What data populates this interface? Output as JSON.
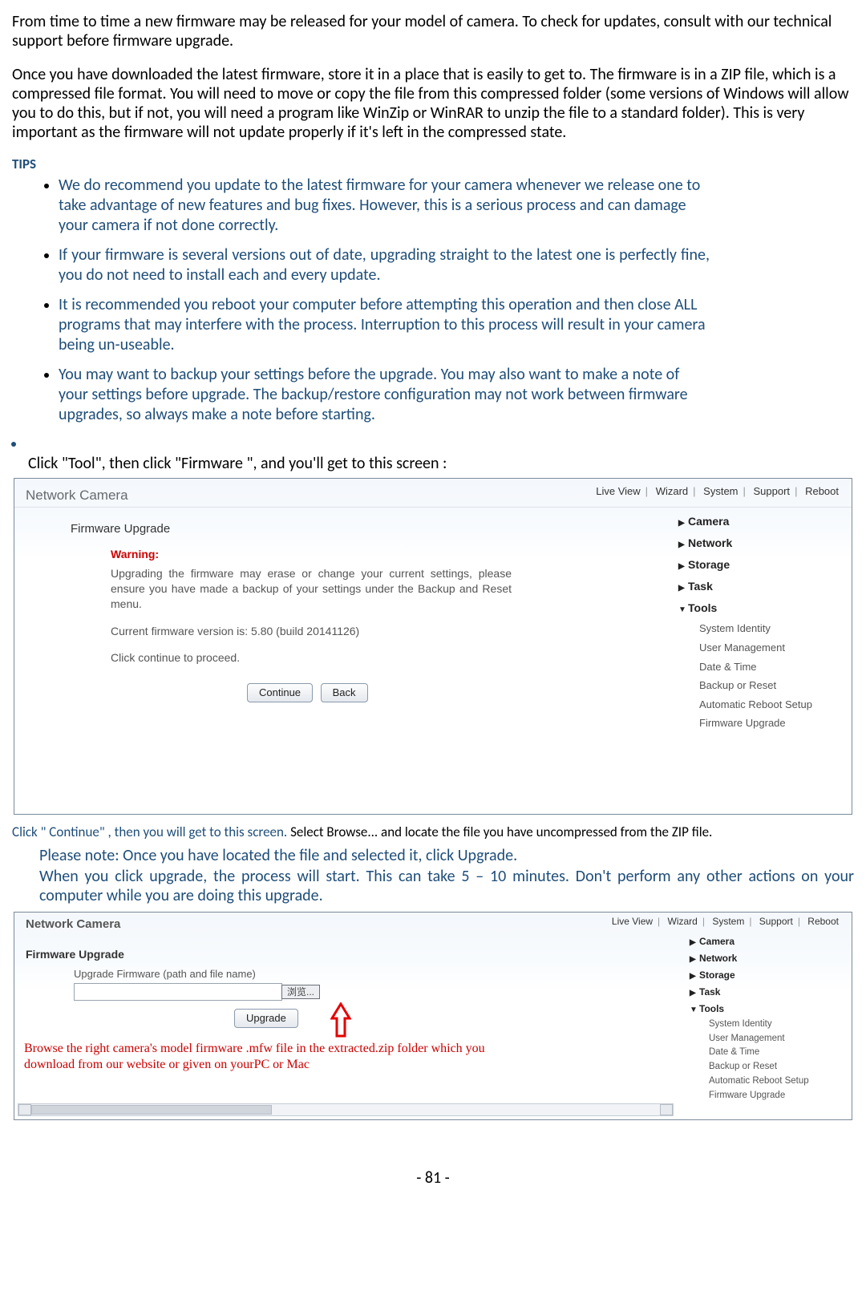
{
  "paragraphs": {
    "p1": "From time to time a new firmware may be released for your model of camera. To check for updates, consult with our technical support before firmware upgrade.",
    "p2": "Once you have downloaded the latest firmware, store it in a place that is easily to get to. The firmware is in a ZIP file, which is a compressed file format. You will need to move or copy the file from this compressed folder (some versions of Windows will allow you to do this, but if not, you will need a program like WinZip or WinRAR to unzip the file to a standard folder). This is very important as the firmware will not update properly if it's left in the compressed state."
  },
  "tips_heading": "TIPS",
  "tips": [
    "We do recommend you update to the latest firmware for your camera whenever we release one to take advantage of new features and bug fixes. However, this is a serious process and can damage your camera if not done correctly.",
    "If your firmware is several versions out of date, upgrading straight to the latest one is perfectly fine, you do not need to install each and every update.",
    "It is recommended you reboot your computer before attempting this operation and then close ALL programs that may interfere with the process. Interruption to this process will result in your camera being un-useable.",
    "You may want to backup your settings before the upgrade. You may also want to make a note of your settings before upgrade. The backup/restore configuration may not work between firmware upgrades, so always make a note before starting."
  ],
  "click_instruction": "Click \"Tool\", then click \"Firmware \", and you'll get to this screen :",
  "shot1": {
    "app_title": "Network Camera",
    "topnav": [
      "Live View",
      "Wizard",
      "System",
      "Support",
      "Reboot"
    ],
    "side_groups": [
      "Camera",
      "Network",
      "Storage",
      "Task",
      "Tools"
    ],
    "side_subs": [
      "System Identity",
      "User Management",
      "Date & Time",
      "Backup or Reset",
      "Automatic Reboot Setup",
      "Firmware Upgrade"
    ],
    "panel_title": "Firmware Upgrade",
    "warning_label": "Warning:",
    "warning_text": "Upgrading the firmware may erase or change your current settings, please ensure you have made a backup of your settings under the Backup and Reset menu.",
    "current_version": "Current firmware version is: 5.80 (build 20141126)",
    "click_continue": "Click continue to proceed.",
    "btn_continue": "Continue",
    "btn_back": "Back"
  },
  "between": {
    "continue_blue": "Click \" Continue\" , then you will get to this screen. ",
    "continue_black": "Select Browse... and locate the file you have uncompressed from the ZIP file.",
    "note": "Please note: Once you have located the file and selected it, click Upgrade.",
    "upgrade": "When you click upgrade, the process will start. This can take 5 – 10 minutes. Don't perform any other actions on your computer while you are doing this upgrade."
  },
  "shot2": {
    "app_title": "Network Camera",
    "topnav": [
      "Live View",
      "Wizard",
      "System",
      "Support",
      "Reboot"
    ],
    "side_groups": [
      "Camera",
      "Network",
      "Storage",
      "Task",
      "Tools"
    ],
    "side_subs": [
      "System Identity",
      "User Management",
      "Date & Time",
      "Backup or Reset",
      "Automatic Reboot Setup",
      "Firmware Upgrade"
    ],
    "panel_title": "Firmware Upgrade",
    "path_label": "Upgrade Firmware (path and file name)",
    "browse_cn": "浏览...",
    "btn_upgrade": "Upgrade",
    "red_note": "Browse the right camera's model firmware .mfw file in the extracted.zip folder which you download from our website or given on yourPC or Mac"
  },
  "page_number": "- 81 -"
}
